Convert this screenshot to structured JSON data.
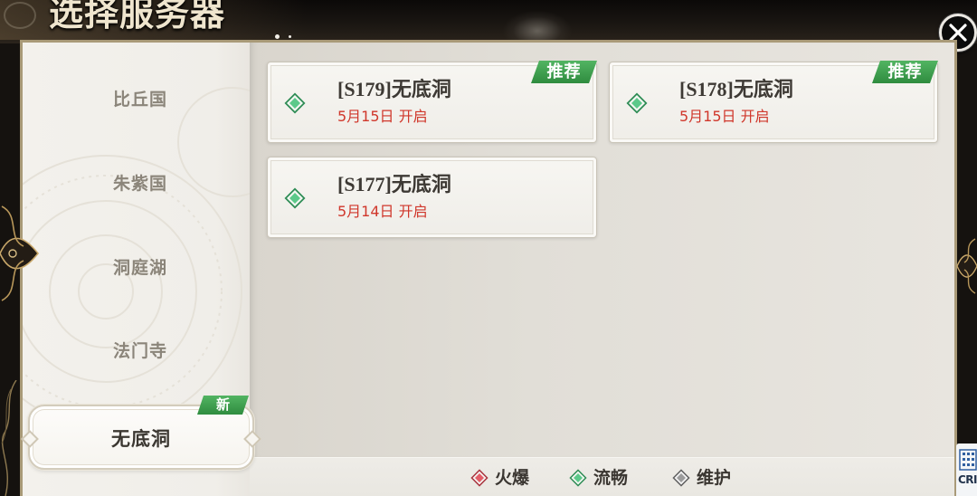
{
  "header": {
    "title": "选择服务器",
    "close_icon": "close-icon"
  },
  "sidebar": {
    "items": [
      {
        "label": "比丘国",
        "selected": false
      },
      {
        "label": "朱紫国",
        "selected": false
      },
      {
        "label": "洞庭湖",
        "selected": false
      },
      {
        "label": "法门寺",
        "selected": false
      },
      {
        "label": "无底洞",
        "selected": true,
        "badge": "新"
      }
    ]
  },
  "servers": [
    {
      "name": "[S179]无底洞",
      "open_time": "5月15日 开启",
      "badge": "推荐",
      "status_icon": "green-diamond-icon",
      "status_fill": "#5cc98a",
      "status_edge": "#2e8c55"
    },
    {
      "name": "[S178]无底洞",
      "open_time": "5月15日 开启",
      "badge": "推荐",
      "status_icon": "green-diamond-icon",
      "status_fill": "#5cc98a",
      "status_edge": "#2e8c55"
    },
    {
      "name": "[S177]无底洞",
      "open_time": "5月14日 开启",
      "status_icon": "green-diamond-icon",
      "status_fill": "#5cc98a",
      "status_edge": "#2e8c55"
    }
  ],
  "legend": [
    {
      "label": "火爆",
      "icon": "red-diamond-icon",
      "fill": "#e35d67",
      "edge": "#a8323c"
    },
    {
      "label": "流畅",
      "icon": "green-diamond-icon",
      "fill": "#5cc98a",
      "edge": "#2e8c55"
    },
    {
      "label": "维护",
      "icon": "gray-diamond-icon",
      "fill": "#9c9c9c",
      "edge": "#5f5f5f"
    }
  ],
  "corner_logo": {
    "text": "CRI"
  },
  "colors": {
    "recommend_badge": "#3a9c4b",
    "new_badge": "#3a9c4b",
    "open_time_text": "#d0372b",
    "frame_gold": "#a99a78"
  }
}
